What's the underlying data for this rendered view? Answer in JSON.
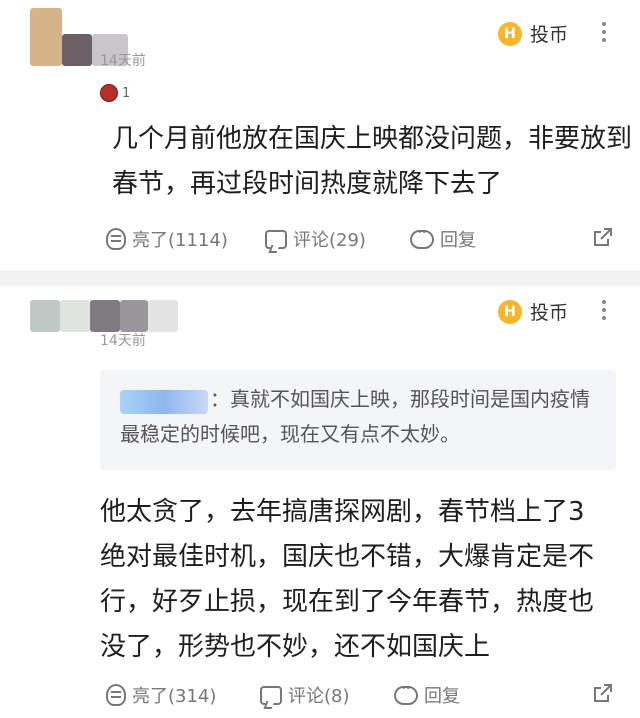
{
  "comments": [
    {
      "time": "14天前",
      "badge_count": "1",
      "coin_label": "投币",
      "coin_symbol": "H",
      "text": "几个月前他放在国庆上映都没问题，非要放到春节，再过段时间热度就降下去了",
      "actions": {
        "like": "亮了(1114)",
        "comment": "评论(29)",
        "reply": "回复"
      }
    },
    {
      "time": "14天前",
      "coin_label": "投币",
      "coin_symbol": "H",
      "quote": "：真就不如国庆上映，那段时间是国内疫情最稳定的时候吧，现在又有点不太妙。",
      "text": "他太贪了，去年搞唐探网剧，春节档上了3绝对最佳时机，国庆也不错，大爆肯定是不行，好歹止损，现在到了今年春节，热度也没了，形势也不妙，还不如国庆上",
      "actions": {
        "like": "亮了(314)",
        "comment": "评论(8)",
        "reply": "回复"
      }
    }
  ],
  "colors": {
    "coin": "#f7b52c",
    "divider": "#f2f2f2",
    "quote_bg": "#f4f5f8"
  }
}
